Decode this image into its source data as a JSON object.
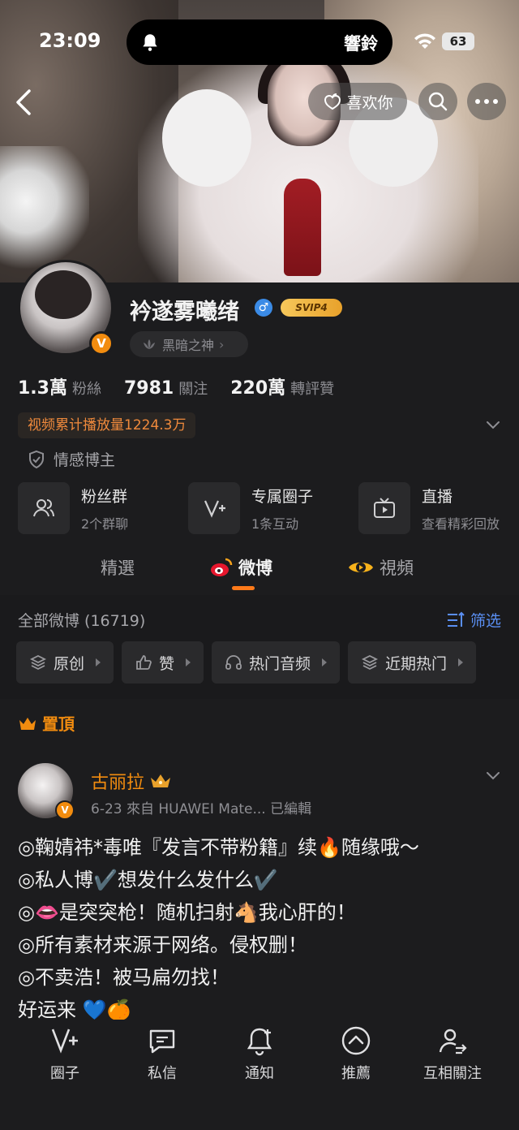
{
  "status_bar": {
    "time": "23:09",
    "island_text": "響鈴",
    "battery": "63"
  },
  "nav": {
    "like_label": "喜欢你"
  },
  "profile": {
    "username": "衿遂雾曦绪",
    "gender_symbol": "♂",
    "svip_label": "SVIP4",
    "verified_badge": "V",
    "rank_label": "黑暗之神",
    "stats": [
      {
        "num": "1.3萬",
        "label": "粉絲"
      },
      {
        "num": "7981",
        "label": "關注"
      },
      {
        "num": "220萬",
        "label": "轉評贊"
      }
    ],
    "play_count": "视频累计播放量1224.3万",
    "verification": "情感博主",
    "tiles": [
      {
        "title": "粉丝群",
        "sub": "2个群聊"
      },
      {
        "title": "专属圈子",
        "sub": "1条互动"
      },
      {
        "title": "直播",
        "sub": "查看精彩回放"
      }
    ],
    "tabs": [
      {
        "label": "精選"
      },
      {
        "label": "微博"
      },
      {
        "label": "視頻"
      }
    ]
  },
  "filters": {
    "all_count": "全部微博 (16719)",
    "sift_label": "筛选",
    "chips": [
      {
        "label": "原创",
        "icon": "layers-icon"
      },
      {
        "label": "赞",
        "icon": "thumb-up-icon"
      },
      {
        "label": "热门音频",
        "icon": "headphones-icon"
      },
      {
        "label": "近期热门",
        "icon": "layers-icon"
      }
    ]
  },
  "feed": {
    "pinned_label": "置頂",
    "post": {
      "author": "古丽拉",
      "author_badge": "V",
      "meta": "6-23  來自 HUAWEI Mate...  已編輯",
      "lines": [
        "◎鞠婧祎*毒唯『发言不带粉籍』续🔥随缘哦～",
        "◎私人博✔️想发什么发什么✔️",
        "◎👄是突突枪！随机扫射🐴我心肝的！",
        "◎所有素材来源于网络。侵权删！",
        "◎不卖浩！被马扁勿找！",
        "好运来 💙🍊"
      ]
    }
  },
  "bottom_bar": [
    {
      "label": "圈子",
      "icon": "circle-v-icon"
    },
    {
      "label": "私信",
      "icon": "chat-icon"
    },
    {
      "label": "通知",
      "icon": "bell-plus-icon"
    },
    {
      "label": "推薦",
      "icon": "up-circle-icon"
    },
    {
      "label": "互相關注",
      "icon": "mutual-follow-icon"
    }
  ],
  "colors": {
    "accent": "#f28c0f",
    "link": "#5a8ff2",
    "background": "#1c1c1e"
  }
}
